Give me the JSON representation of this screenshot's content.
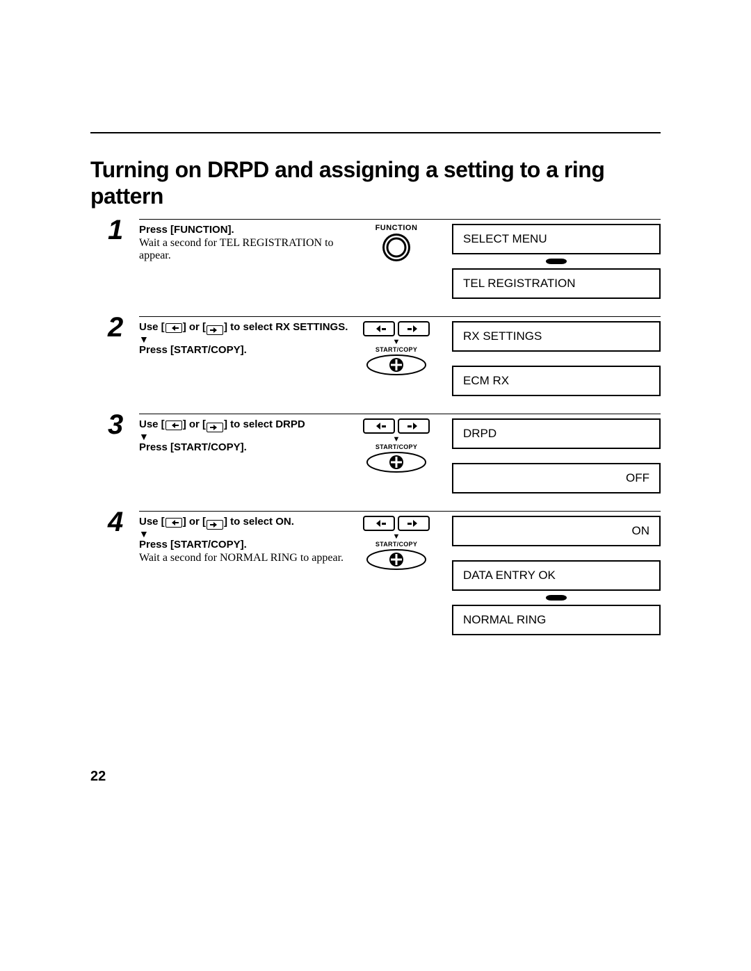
{
  "title": "Turning on DRPD and assigning a setting to a ring pattern",
  "page_number": "22",
  "icons": {
    "function_label": "FUNCTION",
    "start_copy_label": "START/COPY"
  },
  "steps": {
    "s1": {
      "num": "1",
      "line1": "Press [FUNCTION].",
      "line2": "Wait a second for TEL REGISTRATION to appear.",
      "displays": {
        "d1": "SELECT MENU",
        "d2": "TEL REGISTRATION"
      }
    },
    "s2": {
      "num": "2",
      "line1a": "Use [",
      "line1b": "] or [",
      "line1c": "] to select RX SETTINGS.",
      "line2": "Press [START/COPY].",
      "displays": {
        "d1": "RX SETTINGS",
        "d2": "ECM RX"
      }
    },
    "s3": {
      "num": "3",
      "line1a": "Use [",
      "line1b": "] or [",
      "line1c": "] to select DRPD",
      "line2": "Press [START/COPY].",
      "displays": {
        "d1": "DRPD",
        "d2": "OFF"
      }
    },
    "s4": {
      "num": "4",
      "line1a": "Use [",
      "line1b": "] or [",
      "line1c": "] to select ON.",
      "line2": "Press [START/COPY].",
      "line3": "Wait a second for NORMAL RING to appear.",
      "displays": {
        "d1": "ON",
        "d2": "DATA ENTRY OK",
        "d3": "NORMAL RING"
      }
    }
  }
}
